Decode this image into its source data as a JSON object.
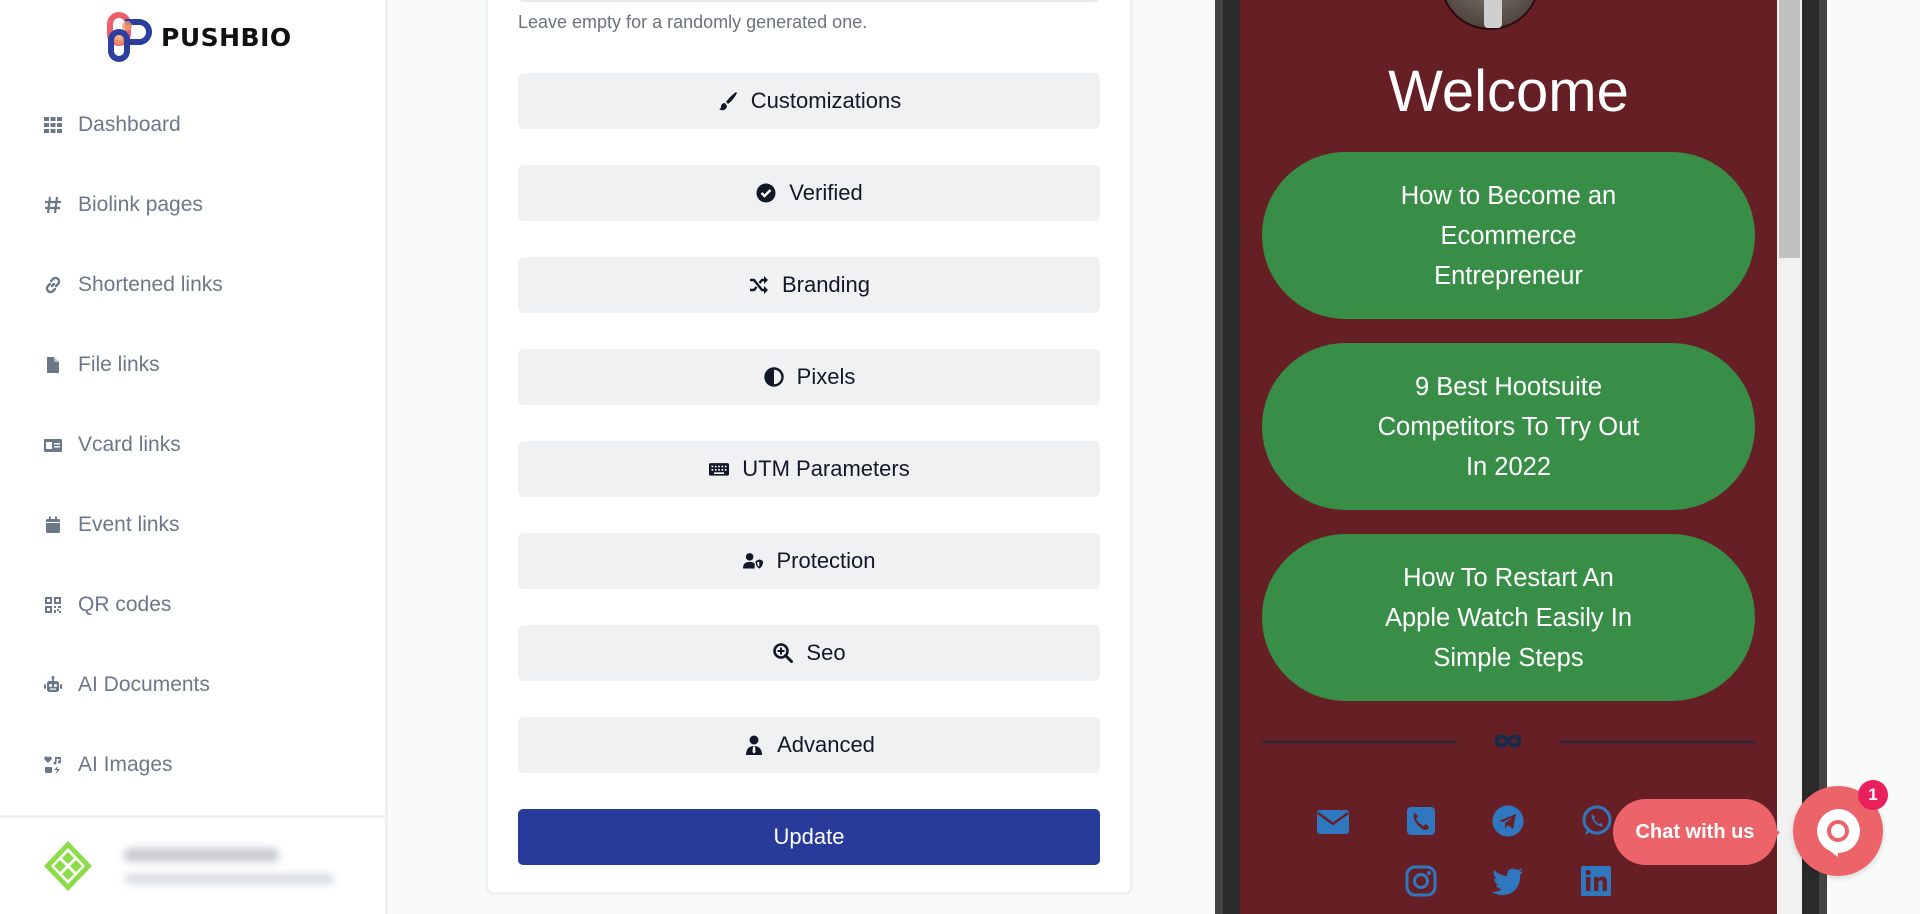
{
  "app": {
    "brand": "PUSHBIO"
  },
  "sidebar": {
    "items": [
      {
        "label": "Dashboard",
        "icon": "grid-icon"
      },
      {
        "label": "Biolink pages",
        "icon": "hashtag-icon"
      },
      {
        "label": "Shortened links",
        "icon": "link-icon"
      },
      {
        "label": "File links",
        "icon": "file-icon"
      },
      {
        "label": "Vcard links",
        "icon": "id-card-icon"
      },
      {
        "label": "Event links",
        "icon": "calendar-icon"
      },
      {
        "label": "QR codes",
        "icon": "qrcode-icon"
      },
      {
        "label": "AI Documents",
        "icon": "robot-icon"
      },
      {
        "label": "AI Images",
        "icon": "icons-icon"
      }
    ],
    "user": {
      "name": "(blurred)",
      "email": "(blurred)"
    }
  },
  "form": {
    "url_hint": "Leave empty for a randomly generated one.",
    "sections": [
      {
        "label": "Customizations",
        "icon": "paint-brush-icon"
      },
      {
        "label": "Verified",
        "icon": "check-circle-icon"
      },
      {
        "label": "Branding",
        "icon": "random-icon"
      },
      {
        "label": "Pixels",
        "icon": "adjust-icon"
      },
      {
        "label": "UTM Parameters",
        "icon": "keyboard-icon"
      },
      {
        "label": "Protection",
        "icon": "user-shield-icon"
      },
      {
        "label": "Seo",
        "icon": "search-plus-icon"
      },
      {
        "label": "Advanced",
        "icon": "user-tie-icon"
      }
    ],
    "update_label": "Update"
  },
  "preview": {
    "title": "Welcome",
    "links": [
      {
        "label": "How to Become an Ecommerce Entrepreneur"
      },
      {
        "label": "9 Best Hootsuite Competitors To Try Out In 2022"
      },
      {
        "label": "How To Restart An Apple Watch Easily In Simple Steps"
      }
    ],
    "socials": [
      "email-icon",
      "phone-icon",
      "telegram-icon",
      "whatsapp-icon",
      "instagram-icon",
      "twitter-icon",
      "linkedin-icon"
    ],
    "colors": {
      "background": "#671f26",
      "button": "#388e46",
      "social": "#2f78bf"
    }
  },
  "chat": {
    "label": "Chat with us",
    "badge": "1"
  }
}
